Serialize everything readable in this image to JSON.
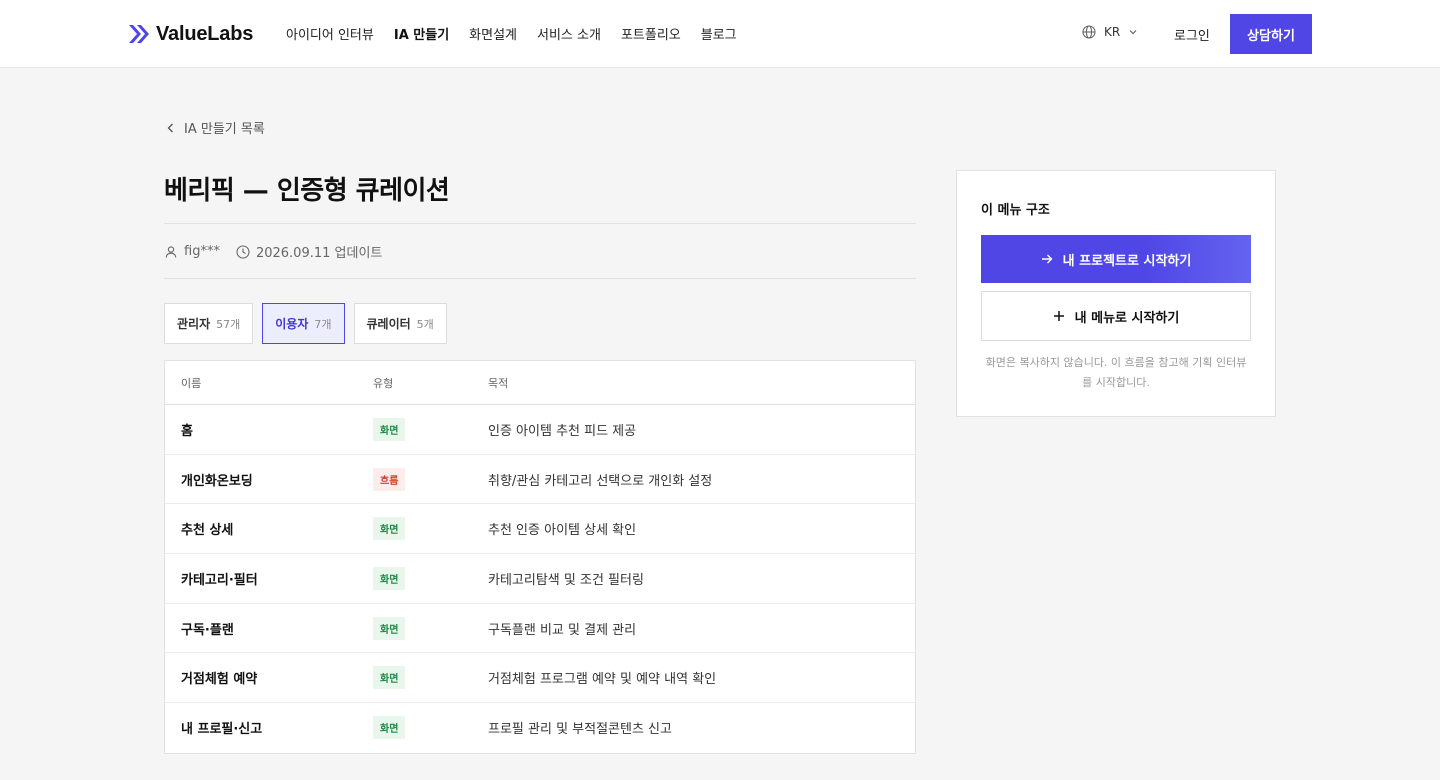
{
  "header": {
    "brand": "ValueLabs",
    "nav": [
      {
        "label": "아이디어 인터뷰",
        "active": false
      },
      {
        "label": "IA 만들기",
        "active": true
      },
      {
        "label": "화면설계",
        "active": false
      },
      {
        "label": "서비스 소개",
        "active": false
      },
      {
        "label": "포트폴리오",
        "active": false
      },
      {
        "label": "블로그",
        "active": false
      }
    ],
    "language": "KR",
    "login_label": "로그인",
    "cta_label": "상담하기"
  },
  "page": {
    "back_label": "IA 만들기 목록",
    "title": "베리픽 — 인증형 큐레이션",
    "author": "fig***",
    "updated": "2026.09.11 업데이트"
  },
  "tabs": [
    {
      "label": "관리자",
      "count": "57개",
      "active": false
    },
    {
      "label": "이용자",
      "count": "7개",
      "active": true
    },
    {
      "label": "큐레이터",
      "count": "5개",
      "active": false
    }
  ],
  "table": {
    "headers": [
      "이름",
      "유형",
      "목적"
    ],
    "rows": [
      {
        "name": "홈",
        "type": "화면",
        "kind": "screen",
        "purpose": "인증 아이템 추천 피드 제공"
      },
      {
        "name": "개인화온보딩",
        "type": "흐름",
        "kind": "flow",
        "purpose": "취향/관심 카테고리 선택으로 개인화 설정"
      },
      {
        "name": "추천 상세",
        "type": "화면",
        "kind": "screen",
        "purpose": "추천 인증 아이템 상세 확인"
      },
      {
        "name": "카테고리·필터",
        "type": "화면",
        "kind": "screen",
        "purpose": "카테고리탐색 및 조건 필터링"
      },
      {
        "name": "구독·플랜",
        "type": "화면",
        "kind": "screen",
        "purpose": "구독플랜 비교 및 결제 관리"
      },
      {
        "name": "거점체험 예약",
        "type": "화면",
        "kind": "screen",
        "purpose": "거점체험 프로그램 예약 및 예약 내역 확인"
      },
      {
        "name": "내 프로필·신고",
        "type": "화면",
        "kind": "screen",
        "purpose": "프로필 관리 및 부적절콘텐츠 신고"
      }
    ]
  },
  "panel": {
    "title": "이 메뉴 구조",
    "primary_label": "내 프로젝트로 시작하기",
    "secondary_label": "내 메뉴로 시작하기",
    "note": "화면은 복사하지 않습니다. 이 흐름을 참고해 기획 인터뷰를 시작합니다."
  },
  "colors": {
    "accent": "#4f46e5",
    "badge_screen_bg": "#e8f6ec",
    "badge_screen_fg": "#1f8a46",
    "badge_flow_bg": "#fdecec",
    "badge_flow_fg": "#d2412f"
  }
}
